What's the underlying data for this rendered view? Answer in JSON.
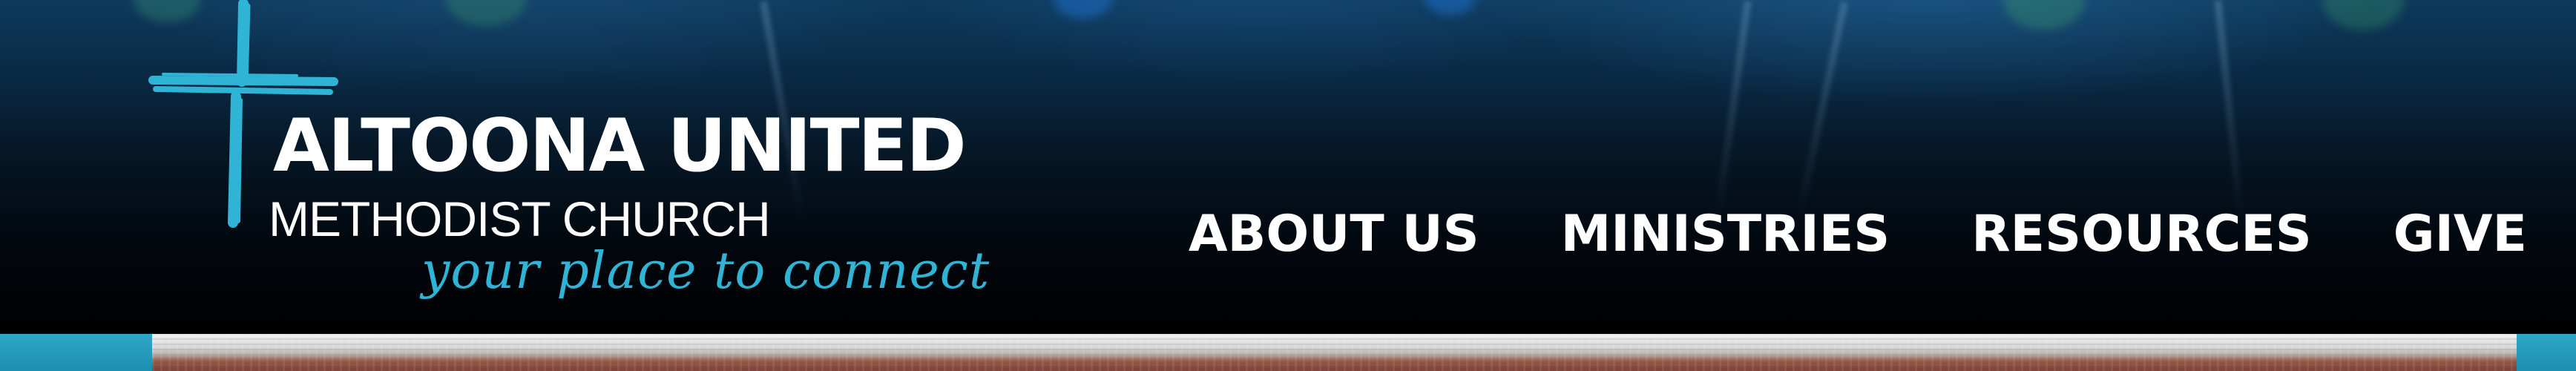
{
  "logo": {
    "line1": "ALTOONA UNITED",
    "line2": "METHODIST CHURCH",
    "tagline": "your place to connect",
    "icon": "cross-icon",
    "text_color": "#ffffff",
    "accent_color": "#2fb4d6"
  },
  "nav": {
    "items": [
      {
        "label": "ABOUT US"
      },
      {
        "label": "MINISTRIES"
      },
      {
        "label": "RESOURCES"
      },
      {
        "label": "GIVE"
      }
    ]
  },
  "colors": {
    "header_top": "#0d3a5c",
    "header_bottom": "#000000",
    "side_accent": "#2ea6c6"
  }
}
